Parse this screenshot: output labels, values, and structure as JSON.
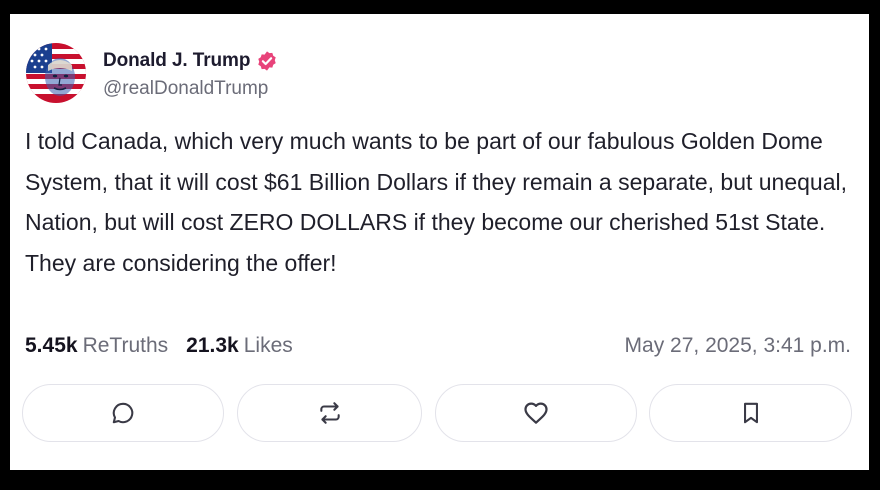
{
  "post": {
    "author": {
      "display_name": "Donald J. Trump",
      "handle": "@realDonaldTrump",
      "verified": true,
      "avatar_icon": "flag-portrait-avatar"
    },
    "text": "I told Canada, which very much wants to be part of our fabulous Golden Dome System, that it will cost $61 Billion Dollars if they remain a separate, but unequal, Nation, but will cost ZERO DOLLARS if they become our cherished 51st State. They are considering the offer!",
    "stats": {
      "retruths_count": "5.45k",
      "retruths_label": "ReTruths",
      "likes_count": "21.3k",
      "likes_label": "Likes"
    },
    "timestamp": "May 27, 2025, 3:41 p.m."
  },
  "actions": [
    {
      "name": "reply",
      "icon": "comment-icon"
    },
    {
      "name": "retruth",
      "icon": "repost-icon"
    },
    {
      "name": "like",
      "icon": "heart-icon"
    },
    {
      "name": "bookmark",
      "icon": "bookmark-icon"
    }
  ],
  "colors": {
    "verified_badge": "#e8437a",
    "text_primary": "#1f1f2a",
    "text_secondary": "#6b6c78",
    "button_border": "#e3e3ea"
  }
}
